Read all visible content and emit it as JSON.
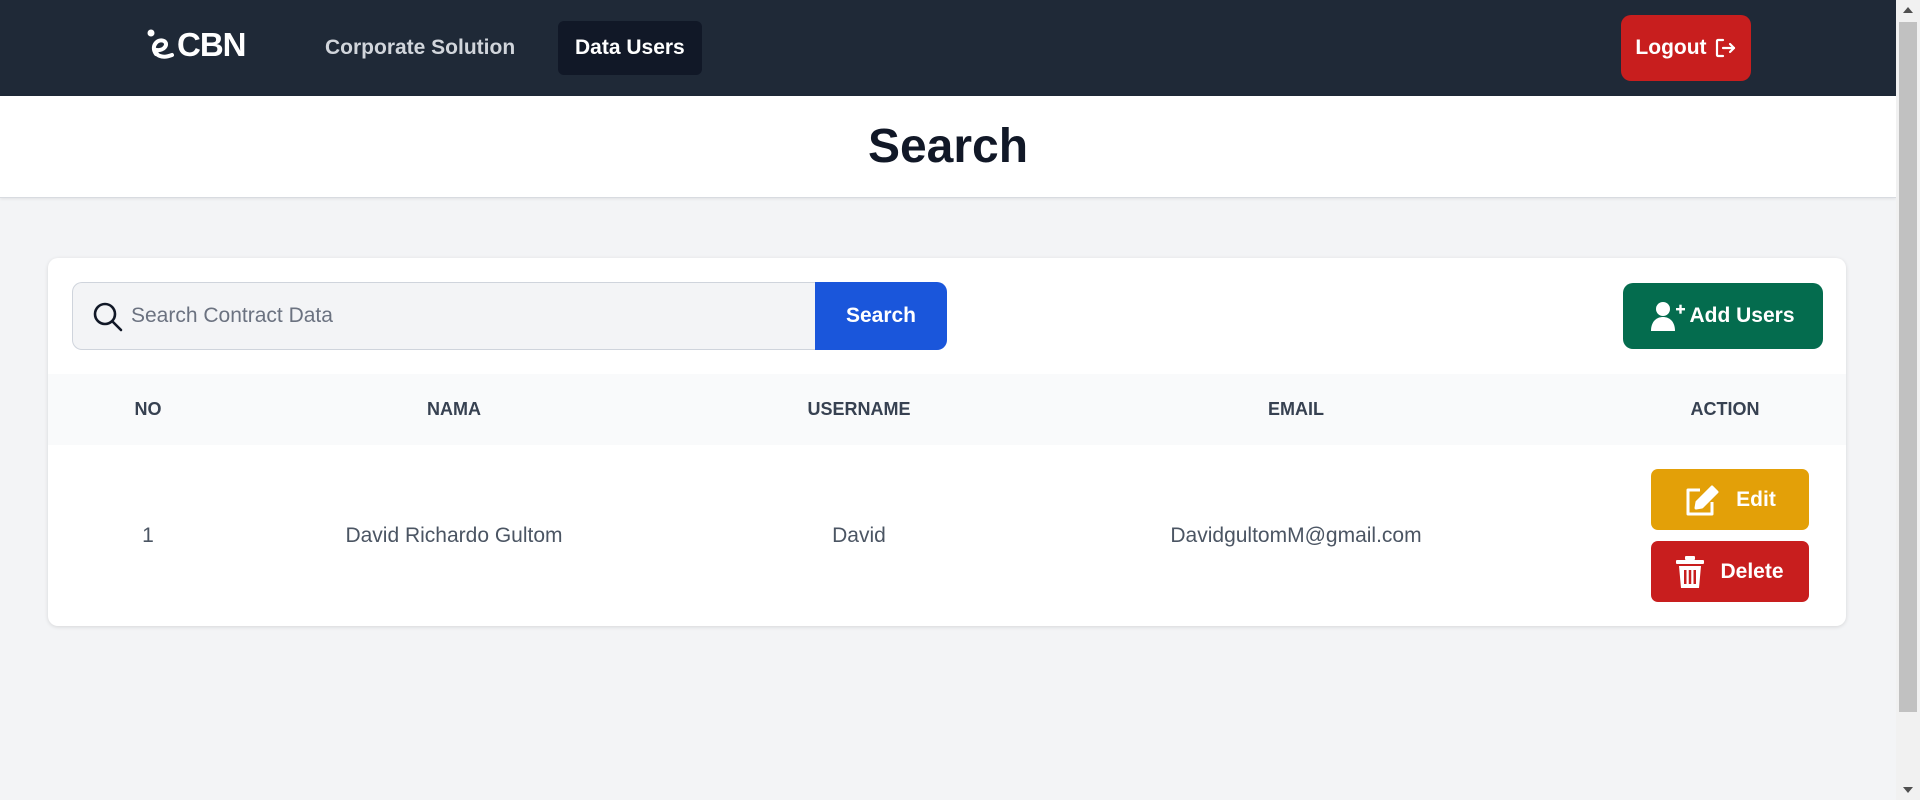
{
  "navbar": {
    "logo_text": "CBN",
    "links": [
      {
        "label": "Corporate Solution"
      },
      {
        "label": "Data Users"
      }
    ],
    "logout_label": "Logout"
  },
  "header": {
    "title": "Search"
  },
  "search": {
    "placeholder": "Search Contract Data",
    "value": "",
    "button_label": "Search"
  },
  "add_users_label": "Add Users",
  "table": {
    "headers": [
      "NO",
      "NAMA",
      "USERNAME",
      "EMAIL",
      "ACTION"
    ],
    "rows": [
      {
        "no": "1",
        "nama": "David Richardo Gultom",
        "username": "David",
        "email": "DavidgultomM@gmail.com"
      }
    ],
    "edit_label": "Edit",
    "delete_label": "Delete"
  },
  "colors": {
    "navbar": "#1f2937",
    "search_button": "#1a56db",
    "add_button": "#046c4e",
    "edit_button": "#e3a008",
    "delete_button": "#c81e1e"
  },
  "icons": [
    "logo-icon",
    "logout-icon",
    "search-icon",
    "user-plus-icon",
    "edit-icon",
    "trash-icon"
  ]
}
